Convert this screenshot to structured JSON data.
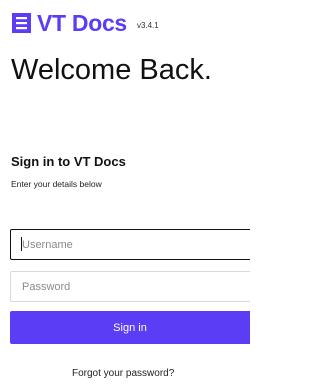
{
  "brand": {
    "icon": "document-lines-icon",
    "name": "VT Docs",
    "version": "v3.4.1",
    "color": "#5b3df5"
  },
  "welcome": {
    "heading": "Welcome Back."
  },
  "signin": {
    "title": "Sign in to VT Docs",
    "subtitle": "Enter your details below",
    "username": {
      "value": "",
      "placeholder": "Username"
    },
    "password": {
      "value": "",
      "placeholder": "Password"
    },
    "button_label": "Sign in",
    "forgot_link": "Forgot your password?"
  }
}
